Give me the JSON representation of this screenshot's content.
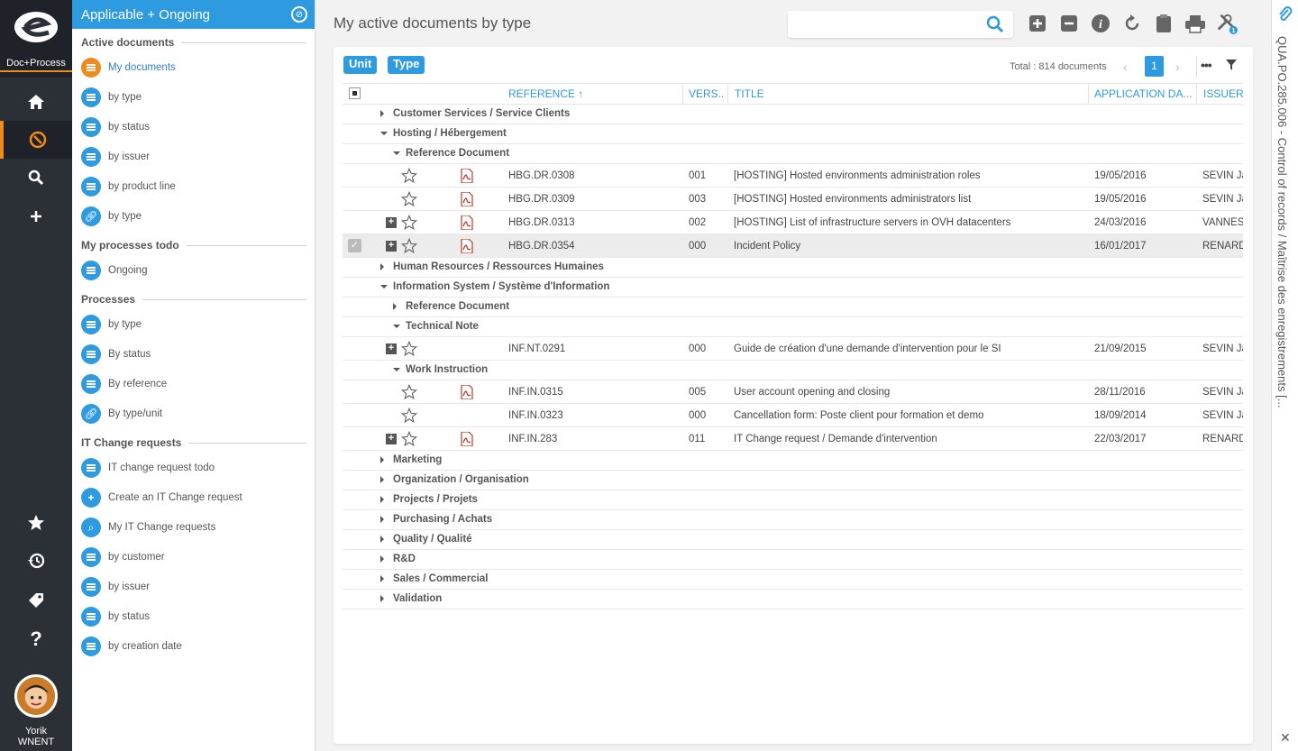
{
  "rail": {
    "brand": "Doc+Process",
    "user_first": "Yorik",
    "user_last": "WNENT"
  },
  "nav": {
    "header": "Applicable + Ongoing",
    "sections": {
      "active_documents": "Active documents",
      "my_processes_todo": "My processes todo",
      "processes": "Processes",
      "it_change_requests": "IT Change requests"
    },
    "active_documents": [
      "My documents",
      "by type",
      "by status",
      "by issuer",
      "by product line",
      "by type"
    ],
    "my_processes_todo": [
      "Ongoing"
    ],
    "processes": [
      "by type",
      "By status",
      "By reference",
      "By type/unit"
    ],
    "it_change_requests": [
      "IT change request todo",
      "Create an IT Change request",
      "My IT Change requests",
      "by customer",
      "by issuer",
      "by status",
      "by creation date"
    ]
  },
  "main": {
    "title": "My active documents by type",
    "search_placeholder": "",
    "chips": [
      "Unit",
      "Type"
    ],
    "total": "Total : 814 documents",
    "page": "1",
    "columns": {
      "reference": "REFERENCE",
      "version": "VERS..",
      "title": "TITLE",
      "application_date": "APPLICATION DA...",
      "issuer": "ISSUER"
    },
    "rows": [
      {
        "type": "group",
        "level": 0,
        "open": false,
        "label": "Customer Services / Service Clients"
      },
      {
        "type": "group",
        "level": 0,
        "open": true,
        "label": "Hosting / Hébergement"
      },
      {
        "type": "group",
        "level": 1,
        "open": true,
        "label": "Reference Document"
      },
      {
        "type": "doc",
        "plus": false,
        "pdf": true,
        "selected": false,
        "ref": "HBG.DR.0308",
        "ver": "001",
        "title": "[HOSTING] Hosted environments administration roles",
        "date": "19/05/2016",
        "issuer": "SEVIN Jac"
      },
      {
        "type": "doc",
        "plus": false,
        "pdf": true,
        "selected": false,
        "ref": "HBG.DR.0309",
        "ver": "003",
        "title": "[HOSTING] Hosted environments administrators list",
        "date": "19/05/2016",
        "issuer": "SEVIN Jac"
      },
      {
        "type": "doc",
        "plus": true,
        "pdf": true,
        "selected": false,
        "ref": "HBG.DR.0313",
        "ver": "002",
        "title": "[HOSTING] List of infrastructure servers in OVH datacenters",
        "date": "24/03/2016",
        "issuer": "VANNEST"
      },
      {
        "type": "doc",
        "plus": true,
        "pdf": true,
        "selected": true,
        "ref": "HBG.DR.0354",
        "ver": "000",
        "title": "Incident Policy",
        "date": "16/01/2017",
        "issuer": "RENARD"
      },
      {
        "type": "group",
        "level": 0,
        "open": false,
        "label": "Human Resources / Ressources Humaines"
      },
      {
        "type": "group",
        "level": 0,
        "open": true,
        "label": "Information System / Système d'Information"
      },
      {
        "type": "group",
        "level": 1,
        "open": false,
        "label": "Reference Document"
      },
      {
        "type": "group",
        "level": 1,
        "open": true,
        "label": "Technical Note"
      },
      {
        "type": "doc",
        "plus": true,
        "pdf": false,
        "selected": false,
        "ref": "INF.NT.0291",
        "ver": "000",
        "title": "Guide de création d'une demande d'intervention pour le SI",
        "date": "21/09/2015",
        "issuer": "SEVIN Jac"
      },
      {
        "type": "group",
        "level": 1,
        "open": true,
        "label": "Work Instruction"
      },
      {
        "type": "doc",
        "plus": false,
        "pdf": true,
        "selected": false,
        "ref": "INF.IN.0315",
        "ver": "005",
        "title": "User account opening and closing",
        "date": "28/11/2016",
        "issuer": "SEVIN Jac"
      },
      {
        "type": "doc",
        "plus": false,
        "pdf": false,
        "selected": false,
        "ref": "INF.IN.0323",
        "ver": "000",
        "title": "Cancellation form: Poste client pour formation et demo",
        "date": "18/09/2014",
        "issuer": "SEVIN Jac"
      },
      {
        "type": "doc",
        "plus": true,
        "pdf": true,
        "selected": false,
        "ref": "INF.IN.283",
        "ver": "011",
        "title": "IT Change request / Demande d'intervention",
        "date": "22/03/2017",
        "issuer": "RENARD"
      },
      {
        "type": "group",
        "level": 0,
        "open": false,
        "label": "Marketing"
      },
      {
        "type": "group",
        "level": 0,
        "open": false,
        "label": "Organization / Organisation"
      },
      {
        "type": "group",
        "level": 0,
        "open": false,
        "label": "Projects / Projets"
      },
      {
        "type": "group",
        "level": 0,
        "open": false,
        "label": "Purchasing / Achats"
      },
      {
        "type": "group",
        "level": 0,
        "open": false,
        "label": "Quality / Qualité"
      },
      {
        "type": "group",
        "level": 0,
        "open": false,
        "label": "R&D"
      },
      {
        "type": "group",
        "level": 0,
        "open": false,
        "label": "Sales / Commercial"
      },
      {
        "type": "group",
        "level": 0,
        "open": false,
        "label": "Validation"
      }
    ]
  },
  "side": {
    "vertical_title": "QUA.PO.285.006 - Control of records / Maîtrise des enregistrements [..."
  },
  "colors": {
    "accent": "#2e9ae0",
    "active": "#ef8a1e",
    "rail": "#2b2f36"
  }
}
